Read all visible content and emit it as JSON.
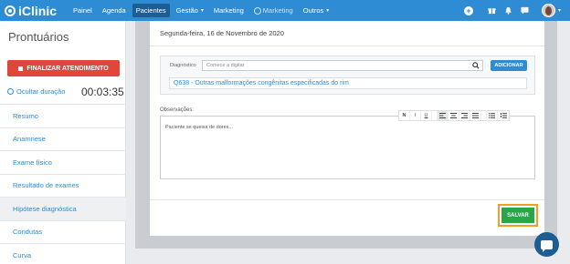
{
  "header": {
    "logo": "iClinic",
    "nav": [
      {
        "label": "Painel"
      },
      {
        "label": "Agenda"
      },
      {
        "label": "Pacientes",
        "active": true
      },
      {
        "label": "Gestão",
        "dropdown": true
      },
      {
        "label": "Marketing"
      },
      {
        "label": "Marketing",
        "icon": "marketing-icon"
      },
      {
        "label": "Outros",
        "dropdown": true
      }
    ],
    "icons": [
      "add-icon",
      "gift-icon",
      "bell-icon",
      "chat-icon",
      "user-avatar"
    ]
  },
  "sidebar": {
    "title": "Prontuários",
    "finalize_label": "FINALIZAR ATENDIMENTO",
    "hide_duration_label": "Ocultar duração",
    "timer": "00:03:35",
    "items": [
      {
        "label": "Resumo"
      },
      {
        "label": "Anamnese"
      },
      {
        "label": "Exame físico"
      },
      {
        "label": "Resultado de exames"
      },
      {
        "label": "Hipótese diagnóstica",
        "active": true
      },
      {
        "label": "Condutas"
      },
      {
        "label": "Curva"
      }
    ]
  },
  "main": {
    "date": "Segunda-feira, 16 de Novembro de 2020",
    "diagnosis": {
      "label": "Diagnóstico",
      "placeholder": "Comece a digitar",
      "add_label": "ADICIONAR",
      "result": "Q638 - Outras malformações congênitas especificadas do rim"
    },
    "observations": {
      "label": "Observações:",
      "text": "Paciente se queixa de dores...",
      "toolbar": [
        "N",
        "I",
        "U",
        "align-left-icon",
        "align-center-icon",
        "align-right-icon",
        "align-justify-icon",
        "bullet-list-icon",
        "numbered-list-icon"
      ]
    },
    "save_label": "SALVAR"
  },
  "colors": {
    "primary": "#2d8cd3",
    "danger": "#e0463a",
    "success": "#2aa54a",
    "highlight": "#f0a020"
  }
}
